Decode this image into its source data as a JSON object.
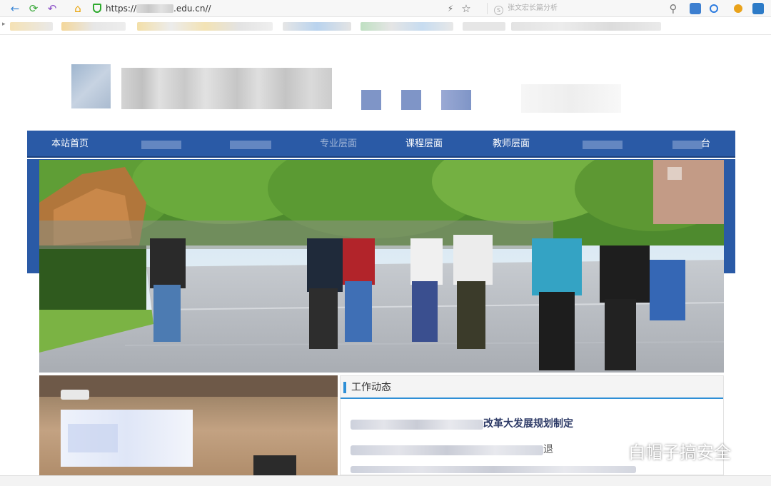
{
  "browser": {
    "url_prefix": "https://",
    "url_suffix": ".edu.cn//",
    "search_placeholder": "张文宏长篇分析",
    "search_logo": "S",
    "back_glyph": "←",
    "refresh_glyph": "⟳",
    "undo_glyph": "↶",
    "home_glyph": "⌂",
    "bolt_glyph": "⚡",
    "star_glyph": "☆",
    "search_glyph": "⚲",
    "bookmark_arrow": "▸",
    "icons": {
      "back": "back-arrow-icon",
      "refresh": "refresh-icon",
      "undo": "undo-icon",
      "home": "home-icon",
      "secure": "shield-icon",
      "bolt": "lightning-icon",
      "star": "star-icon",
      "search": "search-icon"
    }
  },
  "nav": {
    "items": [
      {
        "label": "本站首页"
      },
      {
        "label": "专业层面"
      },
      {
        "label": "课程层面"
      },
      {
        "label": "教师层面"
      },
      {
        "label": "台"
      }
    ]
  },
  "news": {
    "title": "工作动态",
    "headline_tail": "改革大发展规划制定",
    "line2_tail": "退"
  },
  "watermark": {
    "text": "白帽子搞安全",
    "icon": "wechat-icon"
  },
  "colors": {
    "nav": "#2a5aa6",
    "accent": "#2e8fd6",
    "headline": "#2d3a66"
  }
}
